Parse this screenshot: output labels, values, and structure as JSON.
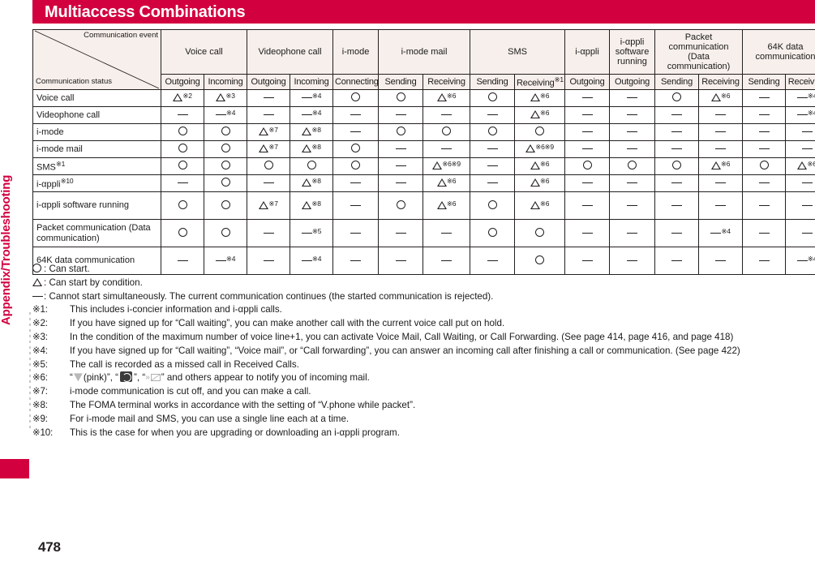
{
  "page": {
    "title": "Multiaccess Combinations",
    "number": "478",
    "sidebar_label": "Appendix/Troubleshooting",
    "accent_color": "#d3003f",
    "header_fill": "#f7efeb"
  },
  "table": {
    "corner": {
      "event_label": "Communication event",
      "status_label": "Communication status"
    },
    "column_groups": [
      {
        "label": "Voice call",
        "subs": [
          "Outgoing",
          "Incoming"
        ]
      },
      {
        "label": "Videophone call",
        "subs": [
          "Outgoing",
          "Incoming"
        ]
      },
      {
        "label": "i-mode",
        "subs": [
          "Connecting"
        ]
      },
      {
        "label": "i-mode mail",
        "subs": [
          "Sending",
          "Receiving"
        ]
      },
      {
        "label": "SMS",
        "subs": [
          "Sending",
          "Receiving※1"
        ]
      },
      {
        "label": "i-αppli",
        "subs": [
          "Outgoing"
        ]
      },
      {
        "label": "i-αppli software running",
        "subs": [
          "Outgoing"
        ]
      },
      {
        "label": "Packet communication (Data communication)",
        "subs": [
          "Sending",
          "Receiving"
        ]
      },
      {
        "label": "64K data communication",
        "subs": [
          "Sending",
          "Receiving"
        ]
      }
    ],
    "rows": [
      {
        "label": "Voice call",
        "cells": [
          "tri:2",
          "tri:3",
          "dash",
          "dash:4",
          "circ",
          "circ",
          "tri:6",
          "circ",
          "tri:6",
          "dash",
          "dash",
          "circ",
          "tri:6",
          "dash",
          "dash:4"
        ]
      },
      {
        "label": "Videophone call",
        "cells": [
          "dash",
          "dash:4",
          "dash",
          "dash:4",
          "dash",
          "dash",
          "dash",
          "dash",
          "tri:6",
          "dash",
          "dash",
          "dash",
          "dash",
          "dash",
          "dash:4"
        ]
      },
      {
        "label": "i-mode",
        "cells": [
          "circ",
          "circ",
          "tri:7",
          "tri:8",
          "dash",
          "circ",
          "circ",
          "circ",
          "circ",
          "dash",
          "dash",
          "dash",
          "dash",
          "dash",
          "dash"
        ]
      },
      {
        "label": "i-mode mail",
        "cells": [
          "circ",
          "circ",
          "tri:7",
          "tri:8",
          "circ",
          "dash",
          "dash",
          "dash",
          "tri:6※9",
          "dash",
          "dash",
          "dash",
          "dash",
          "dash",
          "dash"
        ]
      },
      {
        "label": "SMS※1",
        "cells": [
          "circ",
          "circ",
          "circ",
          "circ",
          "circ",
          "dash",
          "tri:6※9",
          "dash",
          "tri:6",
          "circ",
          "circ",
          "circ",
          "tri:6",
          "circ",
          "tri:6"
        ]
      },
      {
        "label": "i-αppli※10",
        "cells": [
          "dash",
          "circ",
          "dash",
          "tri:8",
          "dash",
          "dash",
          "tri:6",
          "dash",
          "tri:6",
          "dash",
          "dash",
          "dash",
          "dash",
          "dash",
          "dash"
        ]
      },
      {
        "label": "i-αppli software running",
        "tall": true,
        "cells": [
          "circ",
          "circ",
          "tri:7",
          "tri:8",
          "dash",
          "circ",
          "tri:6",
          "circ",
          "tri:6",
          "dash",
          "dash",
          "dash",
          "dash",
          "dash",
          "dash"
        ]
      },
      {
        "label": "Packet communication (Data communication)",
        "tall": true,
        "cells": [
          "circ",
          "circ",
          "dash",
          "dash:5",
          "dash",
          "dash",
          "dash",
          "circ",
          "circ",
          "dash",
          "dash",
          "dash",
          "dash:4",
          "dash",
          "dash"
        ]
      },
      {
        "label": "64K data communication",
        "tall": true,
        "cells": [
          "dash",
          "dash:4",
          "dash",
          "dash:4",
          "dash",
          "dash",
          "dash",
          "dash",
          "circ",
          "dash",
          "dash",
          "dash",
          "dash",
          "dash",
          "dash:4"
        ]
      }
    ]
  },
  "legend": [
    {
      "symbol": "circle",
      "text": ": Can start."
    },
    {
      "symbol": "triangle",
      "text": ": Can start by condition."
    },
    {
      "symbol": "dash",
      "text": ": Cannot start simultaneously. The current communication continues (the started communication is rejected)."
    }
  ],
  "notes": [
    {
      "key": "※1:",
      "text": "This includes i-concier information and i-αppli calls."
    },
    {
      "key": "※2:",
      "text": "If you have signed up for “Call waiting”, you can make another call with the current voice call put on hold."
    },
    {
      "key": "※3:",
      "text": "In the condition of the maximum number of voice line+1, you can activate Voice Mail, Call Waiting, or Call Forwarding. (See page 414, page 416, and page 418)"
    },
    {
      "key": "※4:",
      "text": "If you have signed up for “Call waiting”, “Voice mail”, or “Call forwarding”, you can answer an incoming call after finishing a call or communication. (See page 422)"
    },
    {
      "key": "※5:",
      "text": "The call is recorded as a missed call in Received Calls."
    },
    {
      "key": "※6:",
      "icons": true,
      "text_pre": "“",
      "text_mid1": "(pink)”, “",
      "text_mid2": "”, “",
      "text_post": "” and others appear to notify you of incoming mail."
    },
    {
      "key": "※7:",
      "text": "i-mode communication is cut off, and you can make a call."
    },
    {
      "key": "※8:",
      "text": "The FOMA terminal works in accordance with the setting of “V.phone while packet”."
    },
    {
      "key": "※9:",
      "text": "For i-mode mail and SMS, you can use a single line each at a time."
    },
    {
      "key": "※10:",
      "text": "This is the case for when you are upgrading or downloading an i-αppli program."
    }
  ]
}
